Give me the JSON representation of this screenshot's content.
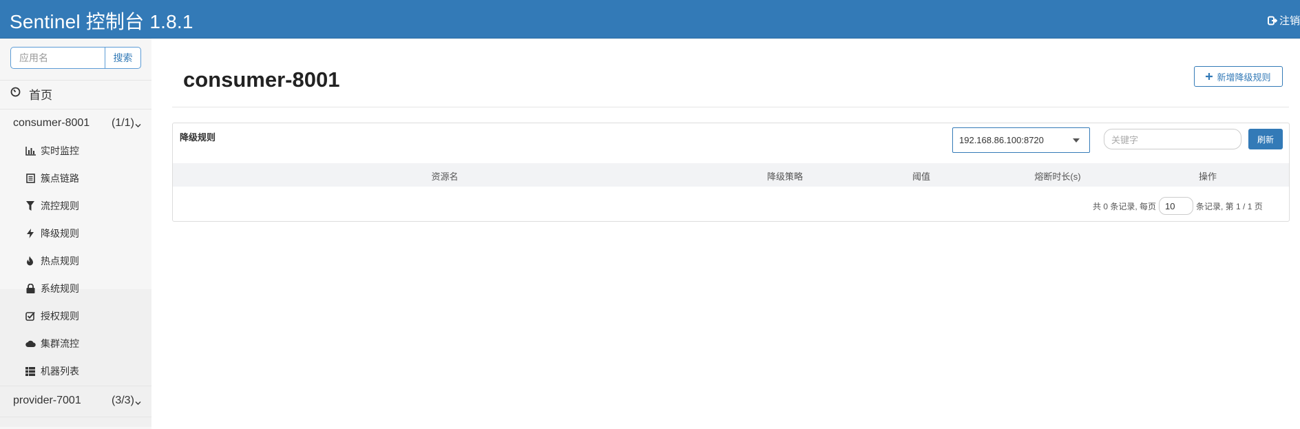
{
  "header": {
    "brand": "Sentinel 控制台 1.8.1",
    "logout_label": "注销"
  },
  "sidebar": {
    "search_placeholder": "应用名",
    "search_button": "搜索",
    "home_label": "首页",
    "apps": [
      {
        "name": "consumer-8001",
        "count": "(1/1)",
        "items": [
          {
            "label": "实时监控",
            "icon": "bar-chart-icon"
          },
          {
            "label": "簇点链路",
            "icon": "list-icon"
          },
          {
            "label": "流控规则",
            "icon": "filter-icon"
          },
          {
            "label": "降级规则",
            "icon": "flash-icon"
          },
          {
            "label": "热点规则",
            "icon": "fire-icon"
          },
          {
            "label": "系统规则",
            "icon": "lock-icon"
          },
          {
            "label": "授权规则",
            "icon": "check-icon"
          },
          {
            "label": "集群流控",
            "icon": "cloud-icon"
          },
          {
            "label": "机器列表",
            "icon": "th-list-icon"
          }
        ]
      },
      {
        "name": "provider-7001",
        "count": "(3/3)"
      }
    ]
  },
  "main": {
    "title": "consumer-8001",
    "add_button": "新增降级规则",
    "panel_title": "降级规则",
    "machine_select": "192.168.86.100:8720",
    "keyword_placeholder": "关键字",
    "refresh_button": "刷新",
    "columns": [
      "资源名",
      "降级策略",
      "阈值",
      "熔断时长(s)",
      "操作"
    ],
    "pager": {
      "prefix": "共 0 条记录, 每页",
      "page_size": "10",
      "suffix": "条记录, 第 1 / 1 页"
    }
  },
  "colors": {
    "header_bg": "#337ab7",
    "accent": "#337ab7",
    "sidebar_bg": "#f6f6f6"
  }
}
